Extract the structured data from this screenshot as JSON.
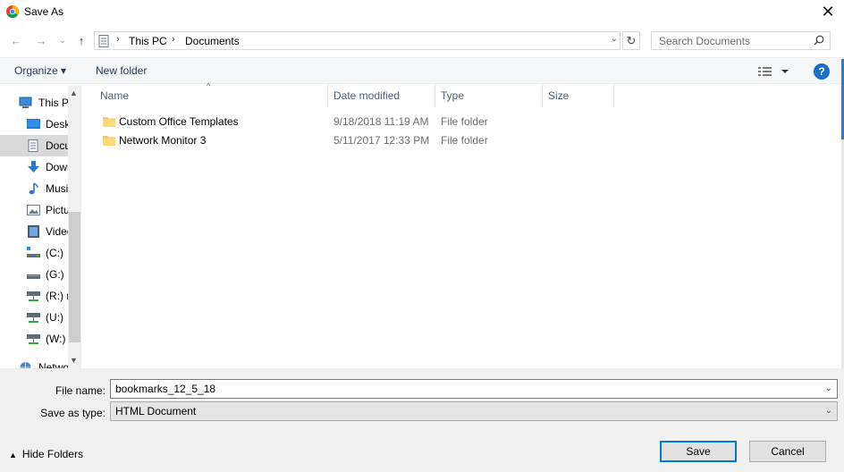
{
  "window": {
    "title": "Save As",
    "close_glyph": "✕"
  },
  "nav": {
    "back_glyph": "←",
    "forward_glyph": "→",
    "recent_glyph": "⌄",
    "up_glyph": "↑",
    "breadcrumb": [
      "This PC",
      "Documents"
    ],
    "refresh_glyph": "↻",
    "search_placeholder": "Search Documents"
  },
  "toolbar": {
    "organize_label": "Organize ▾",
    "new_folder_label": "New folder",
    "help_label": "?"
  },
  "sidebar": {
    "items": [
      {
        "label": "This PC",
        "icon": "computer-icon"
      },
      {
        "label": "Desktop",
        "icon": "desktop-icon"
      },
      {
        "label": "Documents",
        "icon": "documents-icon",
        "selected": true
      },
      {
        "label": "Downloads",
        "icon": "downloads-icon"
      },
      {
        "label": "Music",
        "icon": "music-icon"
      },
      {
        "label": "Pictures",
        "icon": "pictures-icon"
      },
      {
        "label": "Videos",
        "icon": "videos-icon"
      },
      {
        "label": "(C:)",
        "icon": "drive-icon"
      },
      {
        "label": "(G:)",
        "icon": "drive-icon"
      },
      {
        "label": "(R:) r",
        "icon": "network-drive-icon"
      },
      {
        "label": "(U:)",
        "icon": "network-drive-icon"
      },
      {
        "label": "(W:)",
        "icon": "network-drive-icon"
      },
      {
        "label": "Network",
        "icon": "network-icon"
      }
    ]
  },
  "columns": [
    "Name",
    "Date modified",
    "Type",
    "Size"
  ],
  "files": [
    {
      "name": "Custom Office Templates",
      "date": "9/18/2018 11:19 AM",
      "type": "File folder"
    },
    {
      "name": "Network Monitor 3",
      "date": "5/11/2017 12:33 PM",
      "type": "File folder"
    }
  ],
  "form": {
    "filename_label": "File name:",
    "filename_value": "bookmarks_12_5_18",
    "savetype_label": "Save as type:",
    "savetype_value": "HTML Document"
  },
  "footer": {
    "hide_folders_label": "Hide Folders",
    "save_label": "Save",
    "cancel_label": "Cancel"
  },
  "colors": {
    "accent": "#0078d7",
    "link_text": "#1e395b",
    "header_text": "#4c607a",
    "selection": "#d9d9d9"
  }
}
